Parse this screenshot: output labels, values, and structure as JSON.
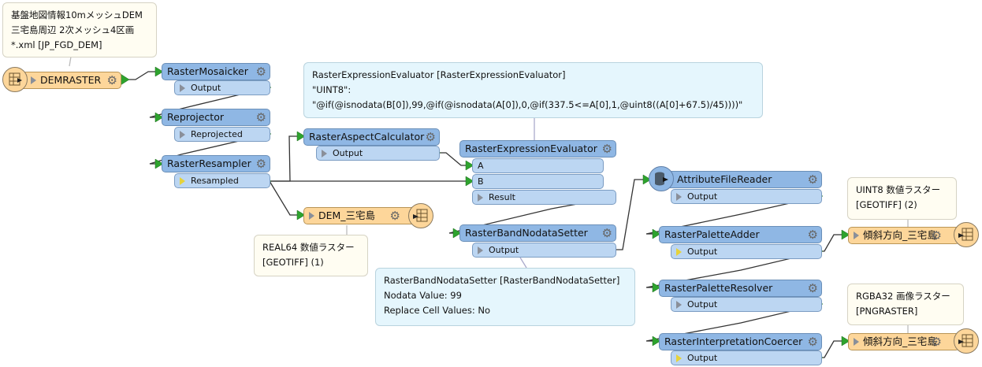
{
  "annotations": [
    {
      "text": "基盤地図情報10mメッシュDEM\n三宅島周辺 2次メッシュ4区画\n*.xml [JP_FGD_DEM]"
    },
    {
      "text": "RasterExpressionEvaluator [RasterExpressionEvaluator]\n\"UINT8\":\n\"@if(@isnodata(B[0]),99,@if(@isnodata(A[0]),0,@if(337.5<=A[0],1,@uint8((A[0]+67.5)/45))))\""
    },
    {
      "text": "REAL64 数値ラスター\n[GEOTIFF] (1)"
    },
    {
      "text": "RasterBandNodataSetter [RasterBandNodataSetter]\nNodata Value: 99\nReplace Cell Values: No"
    },
    {
      "text": "UINT8 数値ラスター\n[GEOTIFF] (2)"
    },
    {
      "text": "RGBA32 画像ラスター\n[PNGRASTER]"
    }
  ],
  "reader": {
    "label": "DEMRASTER",
    "icon": "reader-table-icon"
  },
  "transformers": [
    {
      "label": "RasterMosaicker",
      "ports": [
        "Output"
      ]
    },
    {
      "label": "Reprojector",
      "ports": [
        "Reprojected"
      ]
    },
    {
      "label": "RasterResampler",
      "ports": [
        "Resampled"
      ]
    },
    {
      "label": "RasterAspectCalculator",
      "ports": [
        "Output"
      ]
    },
    {
      "label": "RasterExpressionEvaluator",
      "inputs": [
        "A",
        "B"
      ],
      "ports": [
        "Result"
      ]
    },
    {
      "label": "RasterBandNodataSetter",
      "ports": [
        "Output"
      ]
    },
    {
      "label": "AttributeFileReader",
      "ports": [
        "Output"
      ]
    },
    {
      "label": "RasterPaletteAdder",
      "ports": [
        "Output"
      ]
    },
    {
      "label": "RasterPaletteResolver",
      "ports": [
        "Output"
      ]
    },
    {
      "label": "RasterInterpretationCoercer",
      "ports": [
        "Output"
      ]
    }
  ],
  "writers": [
    {
      "label": "DEM_三宅島"
    },
    {
      "label": "傾斜方向_三宅島"
    },
    {
      "label": "傾斜方向_三宅島"
    }
  ],
  "colors": {
    "transformer": "#8fb7e4",
    "port": "#bcd6f2",
    "feature_type": "#fdd69a",
    "annotation": "#fffdf2",
    "summary_annotation": "#e5f6fd",
    "connector_arrow": "#2ea32e"
  }
}
